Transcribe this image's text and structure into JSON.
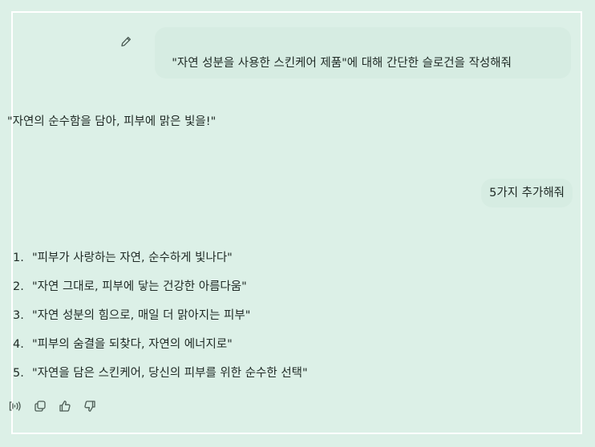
{
  "user_message": "\"자연 성분을 사용한 스킨케어 제품\"에 대해 간단한 슬로건을 작성해줘",
  "assistant_reply": "\"자연의 순수함을 담아, 피부에 맑은 빛을!\"",
  "user_message_2": "5가지 추가해줘",
  "slogans": [
    {
      "num": "1.",
      "text": "\"피부가 사랑하는 자연, 순수하게 빛나다\""
    },
    {
      "num": "2.",
      "text": "\"자연 그대로, 피부에 닿는 건강한 아름다움\""
    },
    {
      "num": "3.",
      "text": "\"자연 성분의 힘으로, 매일 더 맑아지는 피부\""
    },
    {
      "num": "4.",
      "text": "\"피부의 숨결을 되찾다, 자연의 에너지로\""
    },
    {
      "num": "5.",
      "text": "\"자연을 담은 스킨케어, 당신의 피부를 위한 순수한 선택\""
    }
  ],
  "icons": {
    "edit": "pencil-icon",
    "read_aloud": "speaker-icon",
    "copy": "copy-icon",
    "like": "thumbs-up-icon",
    "dislike": "thumbs-down-icon"
  }
}
